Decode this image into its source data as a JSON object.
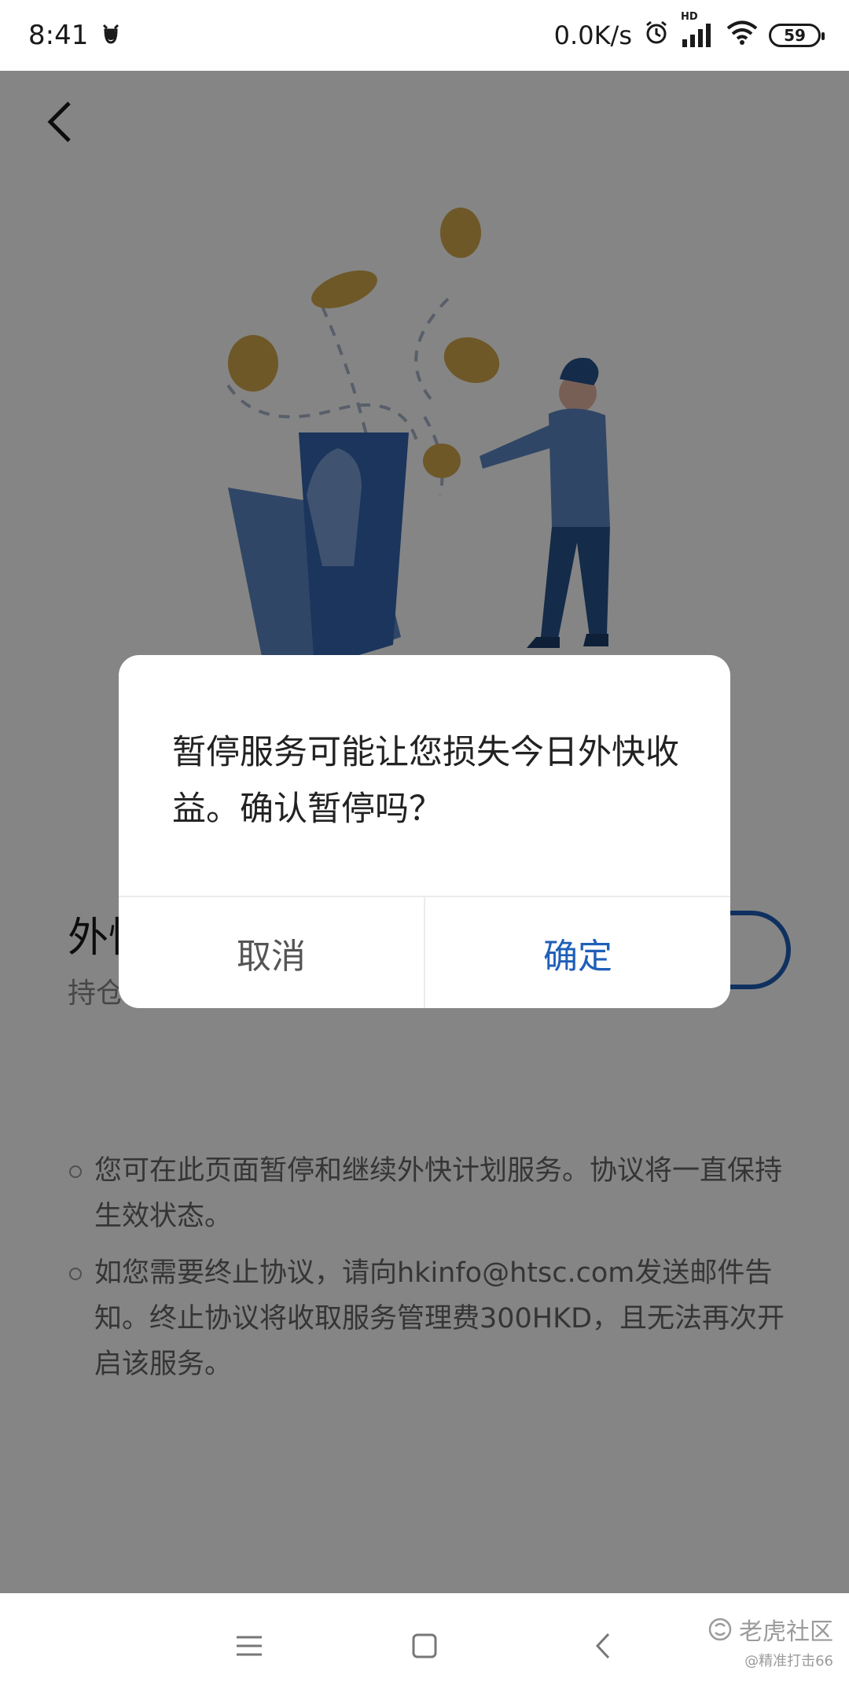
{
  "status_bar": {
    "time": "8:41",
    "network_speed": "0.0K/s",
    "hd_label": "HD",
    "battery": "59",
    "icons": [
      "notification-icon",
      "alarm-icon",
      "signal-icon",
      "wifi-icon",
      "battery-icon"
    ]
  },
  "feature": {
    "title": "外快",
    "subtitle": "持仓"
  },
  "notes": [
    "您可在此页面暂停和继续外快计划服务。协议将一直保持生效状态。",
    "如您需要终止协议，请向hkinfo@htsc.com发送邮件告知。终止协议将收取服务管理费300HKD，且无法再次开启该服务。"
  ],
  "dialog": {
    "message": "暂停服务可能让您损失今日外快收益。确认暂停吗？",
    "cancel_label": "取消",
    "confirm_label": "确定"
  },
  "watermark": {
    "main": "老虎社区",
    "sub": "@精准打击66"
  },
  "colors": {
    "accent": "#1f5fb8",
    "overlay": "rgba(0,0,0,0.48)",
    "coin": "#d4a94d"
  }
}
